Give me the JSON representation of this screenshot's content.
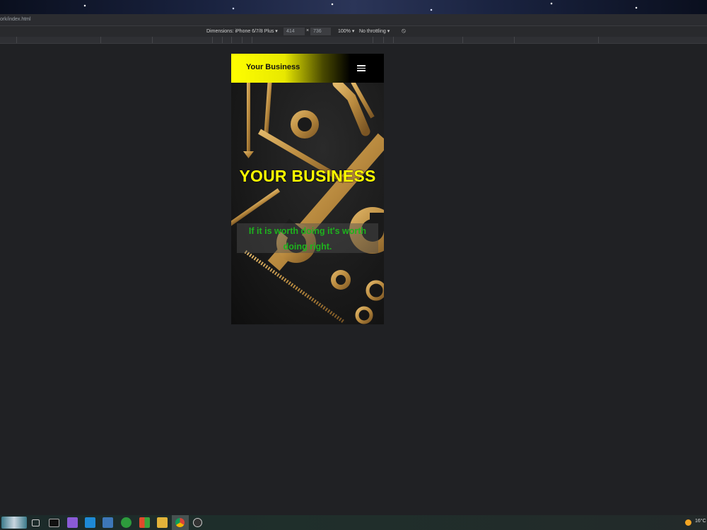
{
  "browser": {
    "url_fragment": "ork/index.html",
    "device_toolbar": {
      "dimensions_label": "Dimensions: iPhone 6/7/8 Plus",
      "width_value": "414",
      "times": "×",
      "height_value": "736",
      "zoom": "100%",
      "throttling": "No throttling"
    }
  },
  "site": {
    "brand": "Your Business",
    "hero_title": "YOUR BUSINESS",
    "tagline": "If it is worth doing it's worth doing right.",
    "colors": {
      "nav_accent": "#ffff00",
      "hero_title": "#ffff00",
      "tagline": "#1db31d"
    }
  },
  "taskbar": {
    "icons": [
      "start-icon",
      "task-view-icon",
      "terminal-icon",
      "visual-studio-icon",
      "vscode-icon",
      "virtualbox-icon",
      "xbox-icon",
      "store-icon",
      "file-explorer-icon",
      "chrome-icon",
      "obs-icon"
    ],
    "temperature": "16°C"
  }
}
